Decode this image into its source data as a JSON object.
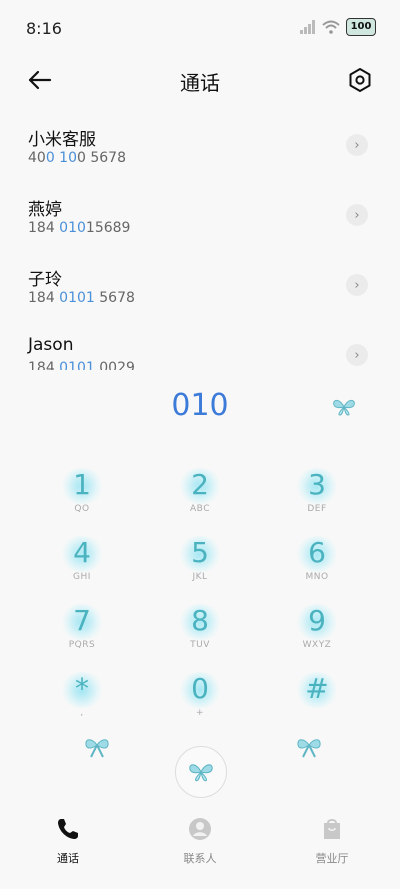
{
  "status": {
    "time": "8:16",
    "battery": "100"
  },
  "header": {
    "title": "通话"
  },
  "results": [
    {
      "name": "小米客服",
      "prefix": "40",
      "match": "0 10",
      "suffix": "0 5678"
    },
    {
      "name": "燕婷",
      "prefix": "184 ",
      "match": "010",
      "suffix": "15689"
    },
    {
      "name": "子玲",
      "prefix": "184 ",
      "match": "0101",
      "suffix": " 5678"
    },
    {
      "name": "Jason",
      "prefix": "184 ",
      "match": "0101",
      "suffix": " 0029"
    }
  ],
  "dialed": "010",
  "keys": [
    {
      "digit": "1",
      "letters": "QO"
    },
    {
      "digit": "2",
      "letters": "ABC"
    },
    {
      "digit": "3",
      "letters": "DEF"
    },
    {
      "digit": "4",
      "letters": "GHI"
    },
    {
      "digit": "5",
      "letters": "JKL"
    },
    {
      "digit": "6",
      "letters": "MNO"
    },
    {
      "digit": "7",
      "letters": "PQRS"
    },
    {
      "digit": "8",
      "letters": "TUV"
    },
    {
      "digit": "9",
      "letters": "WXYZ"
    },
    {
      "digit": "*",
      "letters": ","
    },
    {
      "digit": "0",
      "letters": "+"
    },
    {
      "digit": "#",
      "letters": ""
    }
  ],
  "tabs": [
    {
      "label": "通话",
      "icon": "phone-icon",
      "active": true
    },
    {
      "label": "联系人",
      "icon": "contacts-icon",
      "active": false
    },
    {
      "label": "营业厅",
      "icon": "store-icon",
      "active": false
    }
  ],
  "colors": {
    "accent": "#3d7bd9",
    "highlight": "#4a90d9",
    "key": "#4bb3bf"
  }
}
